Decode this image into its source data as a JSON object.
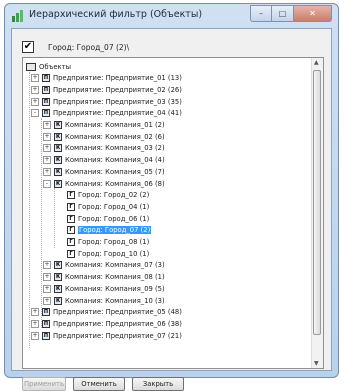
{
  "window": {
    "title": "Иерархический фильтр (Объекты)",
    "controls": {
      "minimize": "–",
      "maximize": "□",
      "close": "✕"
    }
  },
  "filter": {
    "checked": "✔",
    "label": "Город: Город_07 (2)\\"
  },
  "tree": {
    "root_label": "Объекты",
    "nodes": [
      {
        "level": 1,
        "exp": "+",
        "icon": "enterprise",
        "label": "Предприятие: Предприятие_01 (13)"
      },
      {
        "level": 1,
        "exp": "+",
        "icon": "enterprise",
        "label": "Предприятие: Предприятие_02 (26)"
      },
      {
        "level": 1,
        "exp": "+",
        "icon": "enterprise",
        "label": "Предприятие: Предприятие_03 (35)"
      },
      {
        "level": 1,
        "exp": "-",
        "icon": "enterprise",
        "label": "Предприятие: Предприятие_04 (41)"
      },
      {
        "level": 2,
        "exp": "+",
        "icon": "company",
        "label": "Компания: Компания_01 (2)"
      },
      {
        "level": 2,
        "exp": "+",
        "icon": "company",
        "label": "Компания: Компания_02 (6)"
      },
      {
        "level": 2,
        "exp": "+",
        "icon": "company",
        "label": "Компания: Компания_03 (2)"
      },
      {
        "level": 2,
        "exp": "+",
        "icon": "company",
        "label": "Компания: Компания_04 (4)"
      },
      {
        "level": 2,
        "exp": "+",
        "icon": "company",
        "label": "Компания: Компания_05 (7)"
      },
      {
        "level": 2,
        "exp": "-",
        "icon": "company",
        "label": "Компания: Компания_06 (8)"
      },
      {
        "level": 3,
        "exp": "",
        "icon": "city",
        "label": "Город: Город_02 (2)"
      },
      {
        "level": 3,
        "exp": "",
        "icon": "city",
        "label": "Город: Город_04 (1)"
      },
      {
        "level": 3,
        "exp": "",
        "icon": "city",
        "label": "Город: Город_06 (1)"
      },
      {
        "level": 3,
        "exp": "",
        "icon": "city",
        "label": "Город: Город_07 (2)",
        "selected": true
      },
      {
        "level": 3,
        "exp": "",
        "icon": "city",
        "label": "Город: Город_08 (1)"
      },
      {
        "level": 3,
        "exp": "",
        "icon": "city",
        "label": "Город: Город_10 (1)"
      },
      {
        "level": 2,
        "exp": "+",
        "icon": "company",
        "label": "Компания: Компания_07 (3)"
      },
      {
        "level": 2,
        "exp": "+",
        "icon": "company",
        "label": "Компания: Компания_08 (1)"
      },
      {
        "level": 2,
        "exp": "+",
        "icon": "company",
        "label": "Компания: Компания_09 (5)"
      },
      {
        "level": 2,
        "exp": "+",
        "icon": "company",
        "label": "Компания: Компания_10 (3)"
      },
      {
        "level": 1,
        "exp": "+",
        "icon": "enterprise",
        "label": "Предприятие: Предприятие_05 (48)"
      },
      {
        "level": 1,
        "exp": "+",
        "icon": "enterprise",
        "label": "Предприятие: Предприятие_06 (38)"
      },
      {
        "level": 1,
        "exp": "+",
        "icon": "enterprise",
        "label": "Предприятие: Предприятие_07 (21)"
      }
    ]
  },
  "scrollbar": {
    "up": "▲",
    "down": "▼"
  },
  "buttons": {
    "apply": "Применить",
    "cancel": "Отменить",
    "close": "Закрыть"
  },
  "icons": {
    "enterprise_glyph": "П",
    "company_glyph": "К",
    "city_glyph": "Г"
  }
}
